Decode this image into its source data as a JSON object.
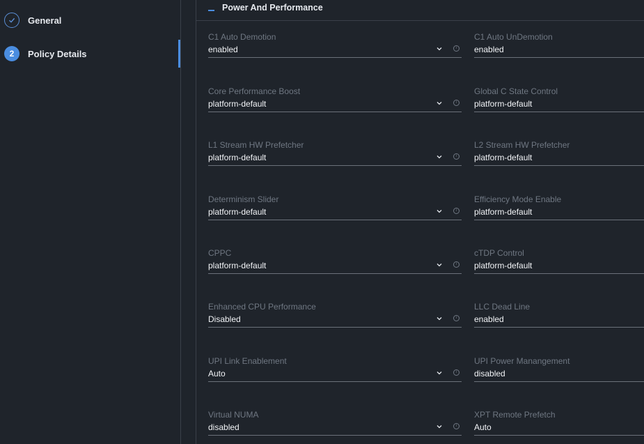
{
  "steps": [
    {
      "label": "General",
      "state": "done"
    },
    {
      "label": "Policy Details",
      "number": "2",
      "state": "active"
    }
  ],
  "section": {
    "title": "Power And Performance"
  },
  "fields": {
    "c1_auto_demotion": {
      "label": "C1 Auto Demotion",
      "value": "enabled"
    },
    "c1_auto_undemotion": {
      "label": "C1 Auto UnDemotion",
      "value": "enabled"
    },
    "core_performance_boost": {
      "label": "Core Performance Boost",
      "value": "platform-default"
    },
    "global_c_state_control": {
      "label": "Global C State Control",
      "value": "platform-default"
    },
    "l1_stream_hw_prefetcher": {
      "label": "L1 Stream HW Prefetcher",
      "value": "platform-default"
    },
    "l2_stream_hw_prefetcher": {
      "label": "L2 Stream HW Prefetcher",
      "value": "platform-default"
    },
    "determinism_slider": {
      "label": "Determinism Slider",
      "value": "platform-default"
    },
    "efficiency_mode_enable": {
      "label": "Efficiency Mode Enable",
      "value": "platform-default"
    },
    "cppc": {
      "label": "CPPC",
      "value": "platform-default"
    },
    "ctdp_control": {
      "label": "cTDP Control",
      "value": "platform-default"
    },
    "enhanced_cpu_performance": {
      "label": "Enhanced CPU Performance",
      "value": "Disabled"
    },
    "llc_dead_line": {
      "label": "LLC Dead Line",
      "value": "enabled"
    },
    "upi_link_enablement": {
      "label": "UPI Link Enablement",
      "value": "Auto"
    },
    "upi_power_management": {
      "label": "UPI Power Manangement",
      "value": "disabled"
    },
    "virtual_numa": {
      "label": "Virtual NUMA",
      "value": "disabled"
    },
    "xpt_remote_prefetch": {
      "label": "XPT Remote Prefetch",
      "value": "Auto"
    }
  },
  "colors": {
    "background": "#1f242b",
    "accent": "#4a8de0",
    "label": "#6f7782",
    "value": "#f1f3f6"
  },
  "icons": {
    "step_done": "check-icon",
    "collapse": "collapse-minus-icon",
    "dropdown": "chevron-down-icon",
    "info": "info-icon"
  }
}
